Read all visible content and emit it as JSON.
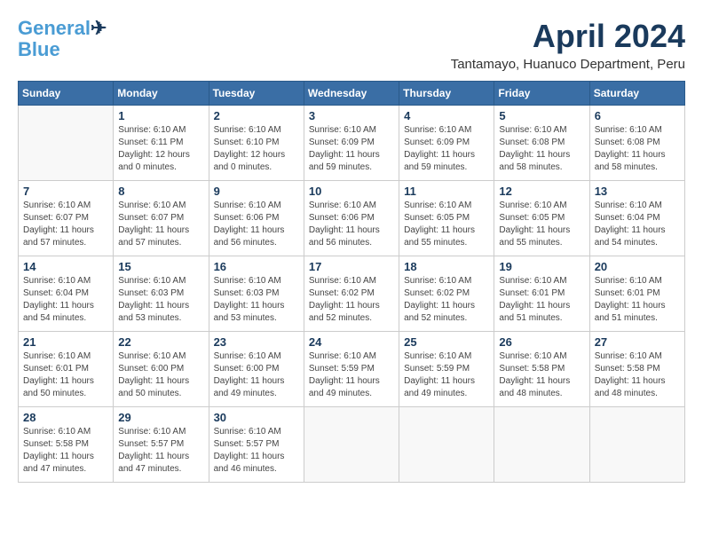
{
  "header": {
    "logo_line1": "General",
    "logo_line2": "Blue",
    "month_title": "April 2024",
    "location": "Tantamayo, Huanuco Department, Peru"
  },
  "weekdays": [
    "Sunday",
    "Monday",
    "Tuesday",
    "Wednesday",
    "Thursday",
    "Friday",
    "Saturday"
  ],
  "weeks": [
    [
      {
        "day": "",
        "info": ""
      },
      {
        "day": "1",
        "info": "Sunrise: 6:10 AM\nSunset: 6:11 PM\nDaylight: 12 hours\nand 0 minutes."
      },
      {
        "day": "2",
        "info": "Sunrise: 6:10 AM\nSunset: 6:10 PM\nDaylight: 12 hours\nand 0 minutes."
      },
      {
        "day": "3",
        "info": "Sunrise: 6:10 AM\nSunset: 6:09 PM\nDaylight: 11 hours\nand 59 minutes."
      },
      {
        "day": "4",
        "info": "Sunrise: 6:10 AM\nSunset: 6:09 PM\nDaylight: 11 hours\nand 59 minutes."
      },
      {
        "day": "5",
        "info": "Sunrise: 6:10 AM\nSunset: 6:08 PM\nDaylight: 11 hours\nand 58 minutes."
      },
      {
        "day": "6",
        "info": "Sunrise: 6:10 AM\nSunset: 6:08 PM\nDaylight: 11 hours\nand 58 minutes."
      }
    ],
    [
      {
        "day": "7",
        "info": "Sunrise: 6:10 AM\nSunset: 6:07 PM\nDaylight: 11 hours\nand 57 minutes."
      },
      {
        "day": "8",
        "info": "Sunrise: 6:10 AM\nSunset: 6:07 PM\nDaylight: 11 hours\nand 57 minutes."
      },
      {
        "day": "9",
        "info": "Sunrise: 6:10 AM\nSunset: 6:06 PM\nDaylight: 11 hours\nand 56 minutes."
      },
      {
        "day": "10",
        "info": "Sunrise: 6:10 AM\nSunset: 6:06 PM\nDaylight: 11 hours\nand 56 minutes."
      },
      {
        "day": "11",
        "info": "Sunrise: 6:10 AM\nSunset: 6:05 PM\nDaylight: 11 hours\nand 55 minutes."
      },
      {
        "day": "12",
        "info": "Sunrise: 6:10 AM\nSunset: 6:05 PM\nDaylight: 11 hours\nand 55 minutes."
      },
      {
        "day": "13",
        "info": "Sunrise: 6:10 AM\nSunset: 6:04 PM\nDaylight: 11 hours\nand 54 minutes."
      }
    ],
    [
      {
        "day": "14",
        "info": "Sunrise: 6:10 AM\nSunset: 6:04 PM\nDaylight: 11 hours\nand 54 minutes."
      },
      {
        "day": "15",
        "info": "Sunrise: 6:10 AM\nSunset: 6:03 PM\nDaylight: 11 hours\nand 53 minutes."
      },
      {
        "day": "16",
        "info": "Sunrise: 6:10 AM\nSunset: 6:03 PM\nDaylight: 11 hours\nand 53 minutes."
      },
      {
        "day": "17",
        "info": "Sunrise: 6:10 AM\nSunset: 6:02 PM\nDaylight: 11 hours\nand 52 minutes."
      },
      {
        "day": "18",
        "info": "Sunrise: 6:10 AM\nSunset: 6:02 PM\nDaylight: 11 hours\nand 52 minutes."
      },
      {
        "day": "19",
        "info": "Sunrise: 6:10 AM\nSunset: 6:01 PM\nDaylight: 11 hours\nand 51 minutes."
      },
      {
        "day": "20",
        "info": "Sunrise: 6:10 AM\nSunset: 6:01 PM\nDaylight: 11 hours\nand 51 minutes."
      }
    ],
    [
      {
        "day": "21",
        "info": "Sunrise: 6:10 AM\nSunset: 6:01 PM\nDaylight: 11 hours\nand 50 minutes."
      },
      {
        "day": "22",
        "info": "Sunrise: 6:10 AM\nSunset: 6:00 PM\nDaylight: 11 hours\nand 50 minutes."
      },
      {
        "day": "23",
        "info": "Sunrise: 6:10 AM\nSunset: 6:00 PM\nDaylight: 11 hours\nand 49 minutes."
      },
      {
        "day": "24",
        "info": "Sunrise: 6:10 AM\nSunset: 5:59 PM\nDaylight: 11 hours\nand 49 minutes."
      },
      {
        "day": "25",
        "info": "Sunrise: 6:10 AM\nSunset: 5:59 PM\nDaylight: 11 hours\nand 49 minutes."
      },
      {
        "day": "26",
        "info": "Sunrise: 6:10 AM\nSunset: 5:58 PM\nDaylight: 11 hours\nand 48 minutes."
      },
      {
        "day": "27",
        "info": "Sunrise: 6:10 AM\nSunset: 5:58 PM\nDaylight: 11 hours\nand 48 minutes."
      }
    ],
    [
      {
        "day": "28",
        "info": "Sunrise: 6:10 AM\nSunset: 5:58 PM\nDaylight: 11 hours\nand 47 minutes."
      },
      {
        "day": "29",
        "info": "Sunrise: 6:10 AM\nSunset: 5:57 PM\nDaylight: 11 hours\nand 47 minutes."
      },
      {
        "day": "30",
        "info": "Sunrise: 6:10 AM\nSunset: 5:57 PM\nDaylight: 11 hours\nand 46 minutes."
      },
      {
        "day": "",
        "info": ""
      },
      {
        "day": "",
        "info": ""
      },
      {
        "day": "",
        "info": ""
      },
      {
        "day": "",
        "info": ""
      }
    ]
  ]
}
